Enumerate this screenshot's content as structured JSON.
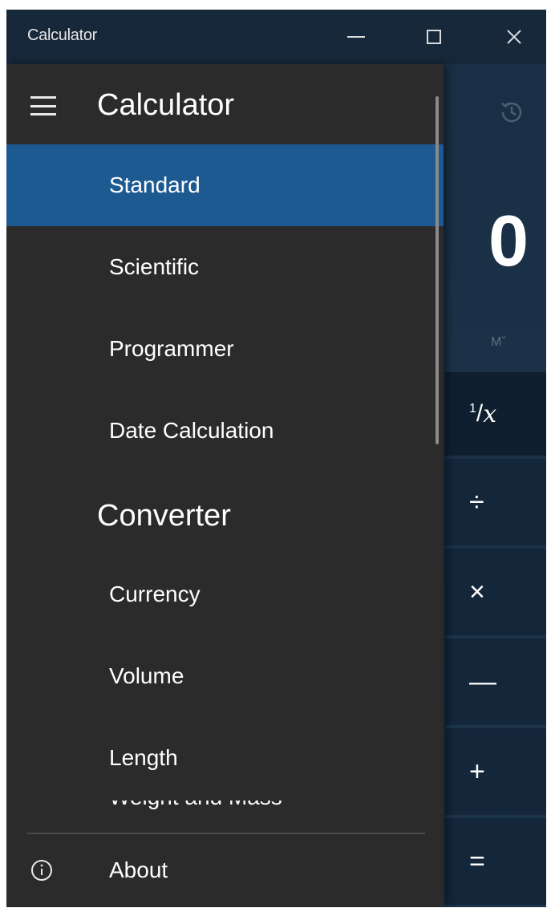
{
  "window": {
    "title": "Calculator"
  },
  "calculator": {
    "display_value": "0",
    "memory_label": "Mˇ",
    "keys": {
      "reciprocal_sup": "1",
      "reciprocal_slash": "/",
      "reciprocal_var": "x",
      "divide": "÷",
      "multiply": "×",
      "minus": "—",
      "plus": "+",
      "equals": "="
    }
  },
  "nav": {
    "header": "Calculator",
    "items": [
      {
        "label": "Standard",
        "selected": true
      },
      {
        "label": "Scientific",
        "selected": false
      },
      {
        "label": "Programmer",
        "selected": false
      },
      {
        "label": "Date Calculation",
        "selected": false
      }
    ],
    "converter_header": "Converter",
    "converter_items": [
      {
        "label": "Currency"
      },
      {
        "label": "Volume"
      },
      {
        "label": "Length"
      },
      {
        "label": "Weight and Mass"
      }
    ],
    "about_label": "About"
  },
  "icons": {
    "hamburger": "hamburger-menu-icon",
    "history": "history-icon",
    "about": "info-icon",
    "minimize": "minimize-icon",
    "maximize": "maximize-icon",
    "close": "close-icon"
  },
  "colors": {
    "nav_background": "#2b2b2b",
    "selected_item": "#1e5a92",
    "title_bar": "#16283a",
    "calculator_background": "#1c344b"
  }
}
